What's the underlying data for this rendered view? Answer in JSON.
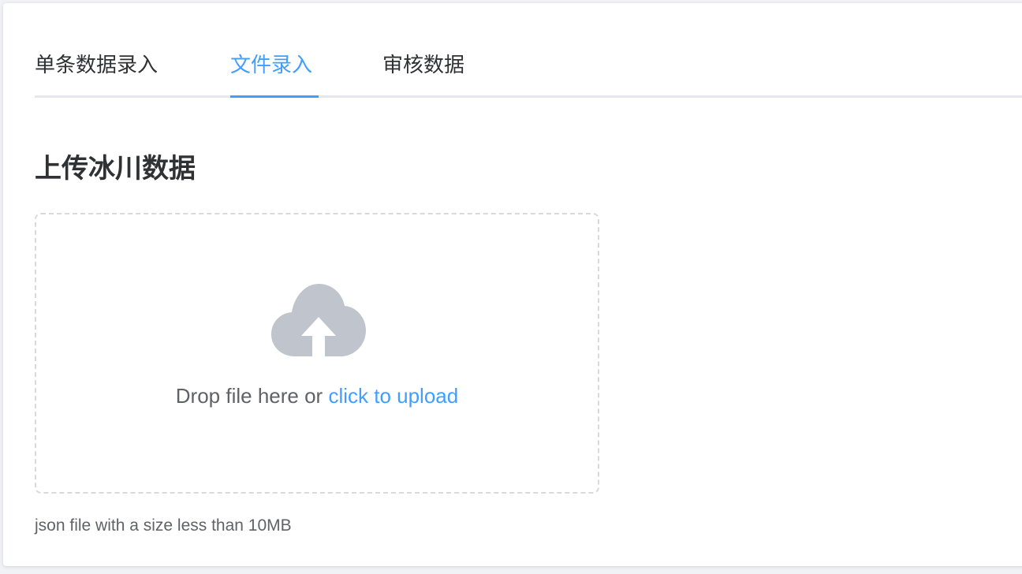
{
  "tabs": [
    {
      "label": "单条数据录入",
      "active": false
    },
    {
      "label": "文件录入",
      "active": true
    },
    {
      "label": "审核数据",
      "active": false
    }
  ],
  "section": {
    "title": "上传冰川数据"
  },
  "upload": {
    "icon": "cloud-upload-icon",
    "prompt_text": "Drop file here or ",
    "link_text": "click to upload",
    "tip": "json file with a size less than 10MB"
  },
  "colors": {
    "accent": "#409eff",
    "text_primary": "#303133",
    "text_regular": "#606266",
    "icon_gray": "#c0c4cc",
    "border": "#d9d9d9"
  }
}
